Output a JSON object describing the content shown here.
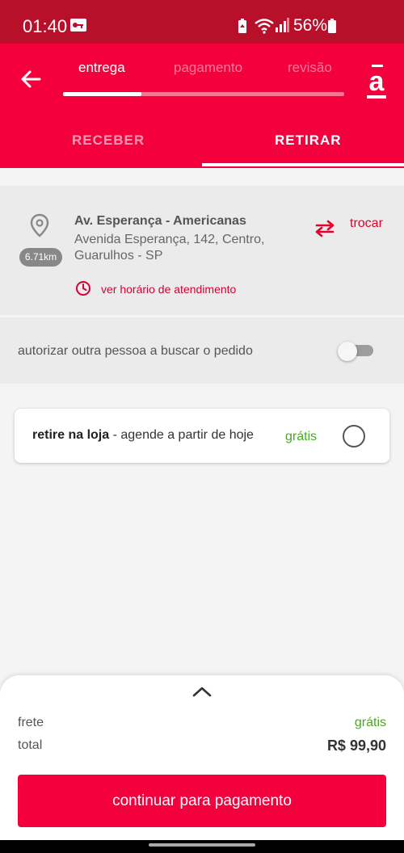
{
  "status_bar": {
    "time": "01:40",
    "battery_percent": "56%",
    "icons": [
      "notification-key-icon",
      "battery-saver-icon",
      "wifi-icon",
      "signal-icon",
      "battery-icon"
    ]
  },
  "header": {
    "back_icon": "arrow-left-icon",
    "steps": [
      {
        "label": "entrega",
        "active": true
      },
      {
        "label": "pagamento",
        "active": false
      },
      {
        "label": "revisão",
        "active": false
      }
    ],
    "progress_fraction": 0.28,
    "logo": "americanas-logo",
    "accent_color": "#f3003d"
  },
  "tabs": {
    "receber": "RECEBER",
    "retirar": "RETIRAR",
    "selected": "retirar"
  },
  "store": {
    "distance": "6.71km",
    "name": "Av. Esperança  - Americanas",
    "address": "Avenida Esperança, 142, Centro, Guarulhos - SP",
    "swap_label": "trocar",
    "hours_link": "ver horário de atendimento"
  },
  "authorize": {
    "label": "autorizar outra pessoa a buscar o pedido",
    "enabled": false
  },
  "option": {
    "title": "retire na loja",
    "subtitle": " - agende a partir de hoje",
    "price": "grátis",
    "selected": false
  },
  "summary": {
    "frete_label": "frete",
    "frete_value": "grátis",
    "total_label": "total",
    "total_value": "R$ 99,90",
    "continue_label": "continuar para pagamento",
    "price_color": "#4aa820"
  }
}
